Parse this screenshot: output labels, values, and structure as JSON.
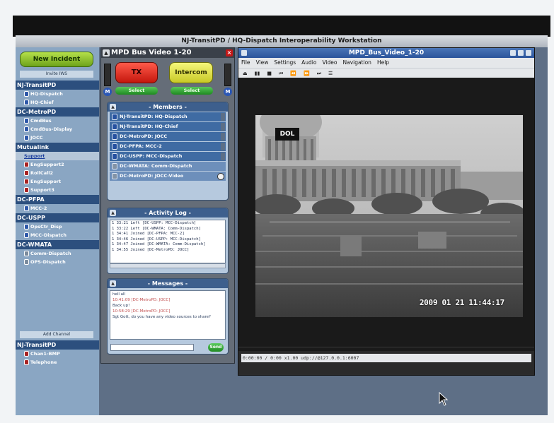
{
  "window_title": "NJ-TransitPD / HQ-Dispatch Interoperability Workstation",
  "left_nav": {
    "new_incident": "New Incident",
    "invite": "Invite IWS",
    "groups": [
      {
        "name": "NJ-TransitPD",
        "items": [
          "HQ-Dispatch",
          "HQ-Chief"
        ]
      },
      {
        "name": "DC-MetroPD",
        "items": [
          "CmdBus",
          "CmdBus-Display",
          "JOCC"
        ]
      },
      {
        "name": "Mutualink",
        "link": "Support",
        "items": [
          "EngSupport2",
          "RollCall2",
          "EngSupport",
          "Support3"
        ]
      },
      {
        "name": "DC-PFPA",
        "items": [
          "MCC-2"
        ]
      },
      {
        "name": "DC-USPP",
        "items": [
          "OpsCtr_Disp",
          "MCC-Dispatch"
        ]
      },
      {
        "name": "DC-WMATA",
        "items": [
          "Comm-Dispatch",
          "OPS-Dispatch"
        ]
      }
    ],
    "add_channel": "Add Channel",
    "channel_group": {
      "name": "NJ-TransitPD",
      "items": [
        "Chan1-BMP",
        "Telephone"
      ]
    }
  },
  "incident": {
    "title": "MPD Bus Video 1-20",
    "tx": "TX",
    "intercom": "Intercom",
    "select_left": "Select",
    "select_right": "Select",
    "meter_label": "M",
    "members_header": "- Members -",
    "members": [
      "NJ-TransitPD: HQ-Dispatch",
      "NJ-TransitPD: HQ-Chief",
      "DC-MetroPD: JOCC",
      "DC-PFPA: MCC-2",
      "DC-USPP: MCC-Dispatch",
      "DC-WMATA: Comm-Dispatch",
      "DC-MetroPD: JOCC-Video"
    ],
    "activity_header": "- Activity Log -",
    "activity": [
      "1 33:21  Left  [DC-USPP: MCC-Dispatch]",
      "1 33:22  Left  [DC-WMATA: Comm-Dispatch]",
      "1 34:41  Joined  [DC-PFPA: MCC-2]",
      "1 34:46  Joined  [DC-USPP: MCC-Dispatch]",
      "1 34:47  Joined  [DC-WMATA: Comm-Dispatch]",
      "1 34:55  Joined  [DC-MetroPD: JOCC]"
    ],
    "messages_header": "- Messages -",
    "messages": [
      {
        "from": "",
        "body": "hell all"
      },
      {
        "from": "10:41:09 [DC-MetroPD: JOCC]",
        "body": "Back up!"
      },
      {
        "from": "10:58:29 [DC-MetroPD: JOCC]",
        "body": "Sgt Gott, do you have any video sources to share?"
      }
    ],
    "send": "Send"
  },
  "video": {
    "title": "MPD_Bus_Video_1-20",
    "menu": [
      "File",
      "View",
      "Settings",
      "Audio",
      "Video",
      "Navigation",
      "Help"
    ],
    "controls": [
      "⏏",
      "▮▮",
      "■",
      "⏮",
      "⏪",
      "⏩",
      "⏭",
      "☰"
    ],
    "status": "0:00:00 / 0:00   x1.00  udp://@127.0.0.1:6007",
    "overlay_tag": "DOL",
    "timestamp": "2009 01 21  11:44:17"
  }
}
